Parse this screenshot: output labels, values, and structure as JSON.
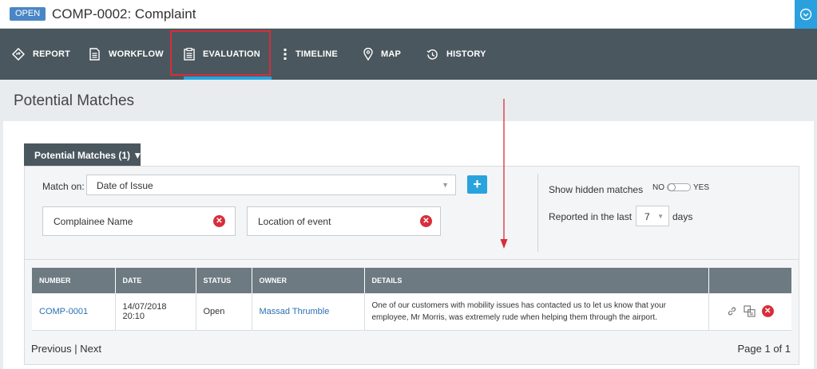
{
  "header": {
    "status_badge": "OPEN",
    "record_title": "COMP-0002: Complaint"
  },
  "nav": {
    "items": [
      {
        "label": "REPORT",
        "icon": "diamond-direction-icon"
      },
      {
        "label": "WORKFLOW",
        "icon": "document-icon"
      },
      {
        "label": "EVALUATION",
        "icon": "clipboard-icon",
        "active": true
      },
      {
        "label": "TIMELINE",
        "icon": "vertical-dots-icon"
      },
      {
        "label": "MAP",
        "icon": "map-pin-icon"
      },
      {
        "label": "HISTORY",
        "icon": "history-icon"
      }
    ]
  },
  "page": {
    "title": "Potential Matches"
  },
  "panel": {
    "tab_label": "Potential Matches (1) ▼",
    "match_on_label": "Match on:",
    "match_on_value": "Date of Issue",
    "add_button": "+",
    "filters": [
      "Complainee Name",
      "Location of event"
    ],
    "show_hidden_label": "Show hidden matches",
    "toggle_no": "NO",
    "toggle_yes": "YES",
    "reported_label": "Reported in the last",
    "days_value": "7",
    "days_suffix": "days"
  },
  "table": {
    "columns": [
      "NUMBER",
      "DATE",
      "STATUS",
      "OWNER",
      "DETAILS",
      ""
    ],
    "rows": [
      {
        "number": "COMP-0001",
        "date": "14/07/2018 20:10",
        "status": "Open",
        "owner": "Massad Thrumble",
        "details": "One of our customers with mobility issues has contacted us to let us know that your employee, Mr Morris, was extremely rude when helping them through the airport."
      }
    ]
  },
  "pager": {
    "previous": "Previous",
    "separator": "|",
    "next": "Next",
    "page_info": "Page 1 of 1"
  },
  "colors": {
    "navbar": "#4b575e",
    "accent": "#29a3dd",
    "danger": "#d92d3b",
    "link": "#2c6fb3",
    "table_header": "#6d7a81"
  }
}
